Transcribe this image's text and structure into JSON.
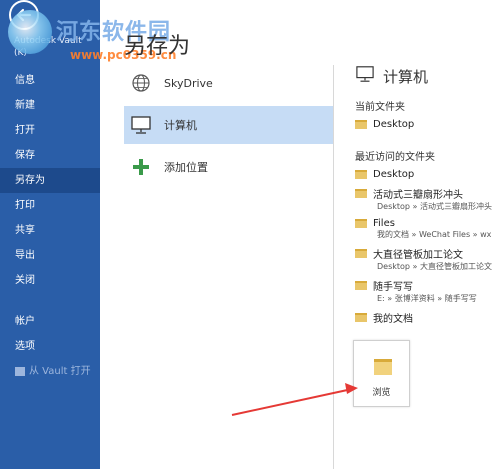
{
  "watermark": {
    "site_name": "河东软件园",
    "url": "www.pc0359.cn"
  },
  "sidebar": {
    "app_name": "Autodesk Vault",
    "app_sub": "(K)",
    "items": [
      {
        "label": "信息"
      },
      {
        "label": "新建"
      },
      {
        "label": "打开"
      },
      {
        "label": "保存"
      },
      {
        "label": "另存为"
      },
      {
        "label": "打印"
      },
      {
        "label": "共享"
      },
      {
        "label": "导出"
      },
      {
        "label": "关闭"
      },
      {
        "label": "帐户"
      },
      {
        "label": "选项"
      },
      {
        "label": "从 Vault 打开"
      }
    ]
  },
  "main": {
    "title": "另存为",
    "locations": [
      {
        "label": "SkyDrive",
        "icon": "globe-icon"
      },
      {
        "label": "计算机",
        "icon": "computer-icon"
      },
      {
        "label": "添加位置",
        "icon": "plus-icon"
      }
    ]
  },
  "right": {
    "title": "计算机",
    "current_label": "当前文件夹",
    "current_folder": "Desktop",
    "recent_label": "最近访问的文件夹",
    "recent": [
      {
        "name": "Desktop",
        "path": ""
      },
      {
        "name": "活动式三瓣扇形冲头",
        "path": "Desktop » 活动式三瓣扇形冲头"
      },
      {
        "name": "Files",
        "path": "我的文档 » WeChat Files » wx"
      },
      {
        "name": "大直径管板加工论文",
        "path": "Desktop » 大直径管板加工论文"
      },
      {
        "name": "随手写写",
        "path": "E: » 张博洋资料 » 随手写写"
      },
      {
        "name": "我的文档",
        "path": ""
      }
    ],
    "browse_label": "浏览"
  },
  "colors": {
    "sidebar_bg": "#2a5ea8",
    "selected_bg": "#c6dcf5",
    "arrow": "#e53935"
  }
}
